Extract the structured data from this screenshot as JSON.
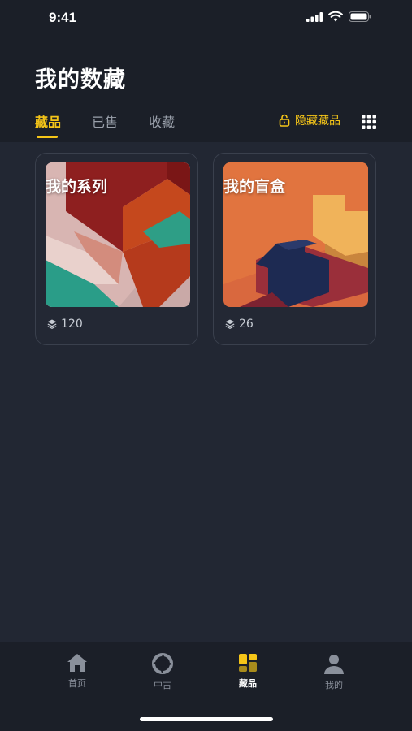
{
  "status": {
    "time": "9:41"
  },
  "page": {
    "title": "我的数藏"
  },
  "tabs": [
    {
      "label": "藏品",
      "active": true
    },
    {
      "label": "已售",
      "active": false
    },
    {
      "label": "收藏",
      "active": false
    }
  ],
  "hide_button": {
    "label": "隐藏藏品",
    "icon": "lock-icon"
  },
  "cards": [
    {
      "title": "我的系列",
      "count": "120",
      "icon": "layers-icon"
    },
    {
      "title": "我的盲盒",
      "count": "26",
      "icon": "layers-icon"
    }
  ],
  "bottom_nav": [
    {
      "label": "首页",
      "icon": "home-icon",
      "active": false
    },
    {
      "label": "中古",
      "icon": "aperture-icon",
      "active": false
    },
    {
      "label": "藏品",
      "icon": "collection-icon",
      "active": true
    },
    {
      "label": "我的",
      "icon": "user-icon",
      "active": false
    }
  ],
  "colors": {
    "accent": "#f5c518",
    "background": "#222733",
    "header": "#1b1f28"
  }
}
